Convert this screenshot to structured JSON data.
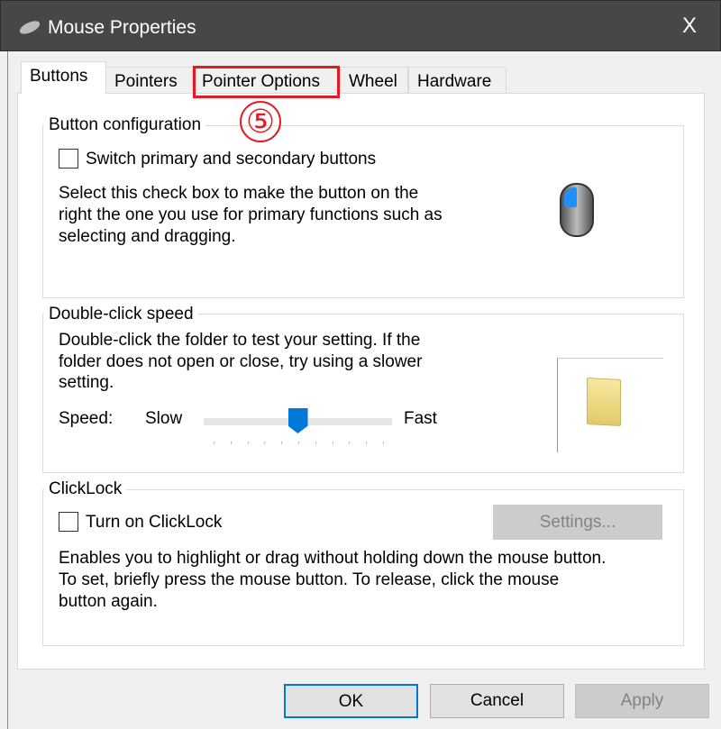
{
  "window": {
    "title": "Mouse Properties",
    "close": "X"
  },
  "tabs": [
    {
      "label": "Buttons",
      "active": true
    },
    {
      "label": "Pointers"
    },
    {
      "label": "Pointer Options"
    },
    {
      "label": "Wheel"
    },
    {
      "label": "Hardware"
    }
  ],
  "annotation": {
    "marker": "⑤",
    "color": "#e31b23"
  },
  "button_config": {
    "title": "Button configuration",
    "checkbox_label": "Switch primary and secondary buttons",
    "checked": false,
    "desc": [
      "Select this check box to make the button on the",
      "right the one you use for primary functions such as",
      "selecting and dragging."
    ]
  },
  "double_click": {
    "title": "Double-click speed",
    "desc": [
      "Double-click the folder to test your setting. If the",
      "folder does not open or close, try using a slower",
      "setting."
    ],
    "speed_label": "Speed:",
    "slow": "Slow",
    "fast": "Fast",
    "speed_value_percent": 50
  },
  "clicklock": {
    "title": "ClickLock",
    "checkbox_label": "Turn on ClickLock",
    "checked": false,
    "settings": "Settings...",
    "desc": [
      "Enables you to highlight or drag without holding down the mouse button.",
      "To set, briefly press the mouse button. To release, click the mouse",
      "button again."
    ]
  },
  "footer": {
    "ok": "OK",
    "cancel": "Cancel",
    "apply": "Apply"
  },
  "colors": {
    "accent": "#0078d7",
    "titlebar": "#474747"
  }
}
